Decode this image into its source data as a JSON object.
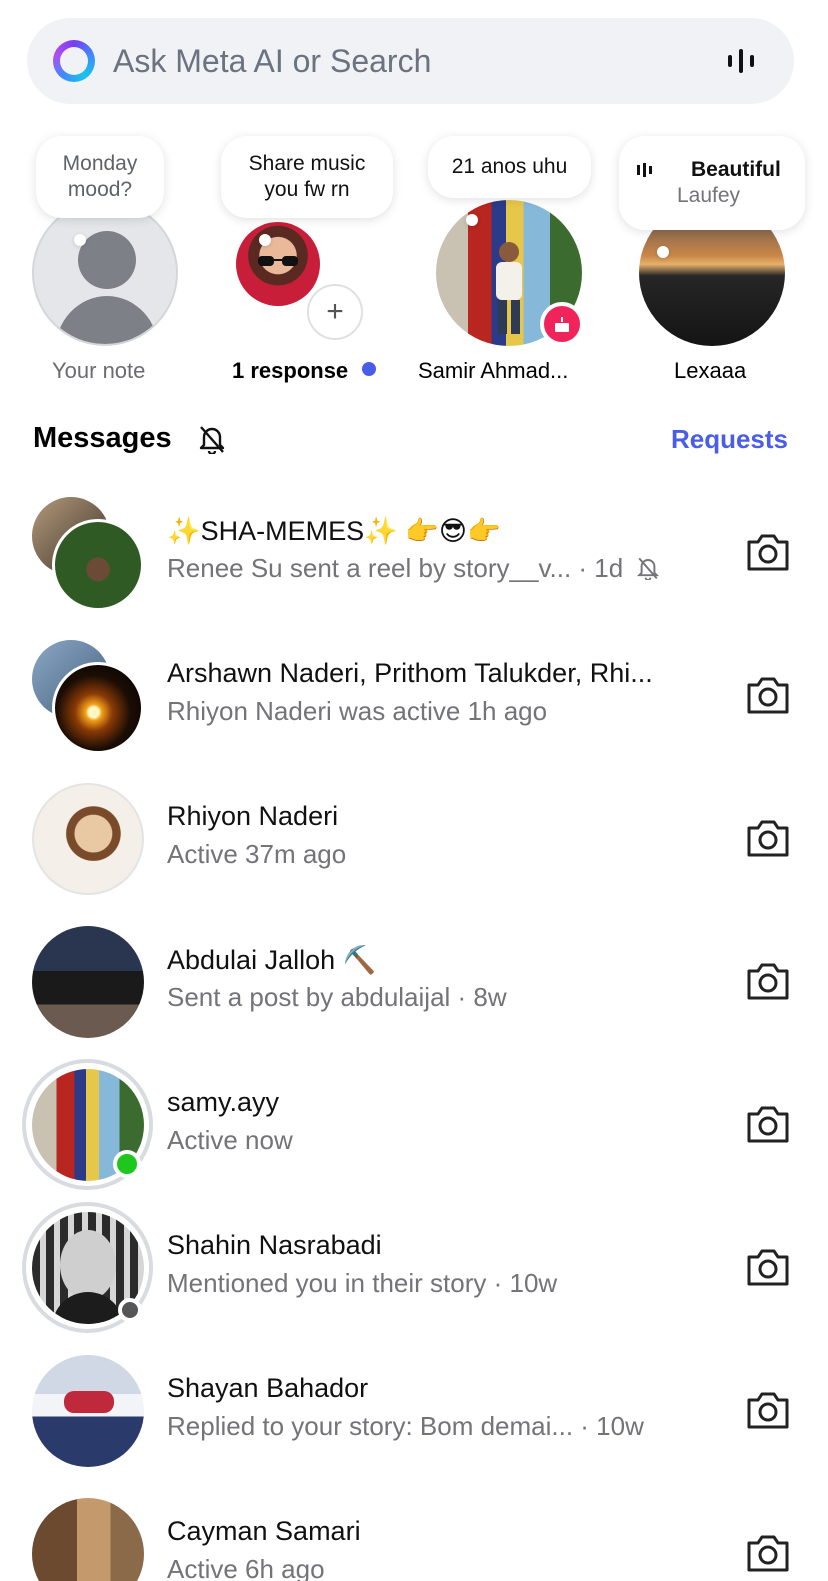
{
  "search": {
    "placeholder": "Ask Meta AI or Search"
  },
  "notes": [
    {
      "bubble": "Monday mood?",
      "label": "Your note"
    },
    {
      "bubble": "Share music you fw rn",
      "label": "1 response"
    },
    {
      "bubble": "21 anos uhu",
      "label": "Samir Ahmad..."
    },
    {
      "bubble_title": "Beautiful",
      "bubble_sub": "Laufey",
      "label": "Lexaaa"
    }
  ],
  "messages_header": {
    "title": "Messages",
    "requests": "Requests"
  },
  "conversations": [
    {
      "name": "✨SHA-MEMES✨ 👉😎👉",
      "sub": "Renee Su sent a reel by story__v... · 1d"
    },
    {
      "name": "Arshawn Naderi, Prithom Talukder, Rhi...",
      "sub": "Rhiyon Naderi was active 1h ago"
    },
    {
      "name": "Rhiyon Naderi",
      "sub": "Active 37m ago"
    },
    {
      "name": "Abdulai Jalloh ⛏️",
      "sub": "Sent a post by abdulaijal · 8w"
    },
    {
      "name": "samy.ayy",
      "sub": "Active now"
    },
    {
      "name": "Shahin Nasrabadi",
      "sub": "Mentioned you in their story · 10w"
    },
    {
      "name": "Shayan Bahador",
      "sub": "Replied to your story: Bom demai... · 10w"
    },
    {
      "name": "Cayman Samari",
      "sub": "Active 6h ago"
    }
  ],
  "colors": {
    "accent": "#4a5de8",
    "online": "#1ec71e",
    "birthday": "#f0245a"
  }
}
